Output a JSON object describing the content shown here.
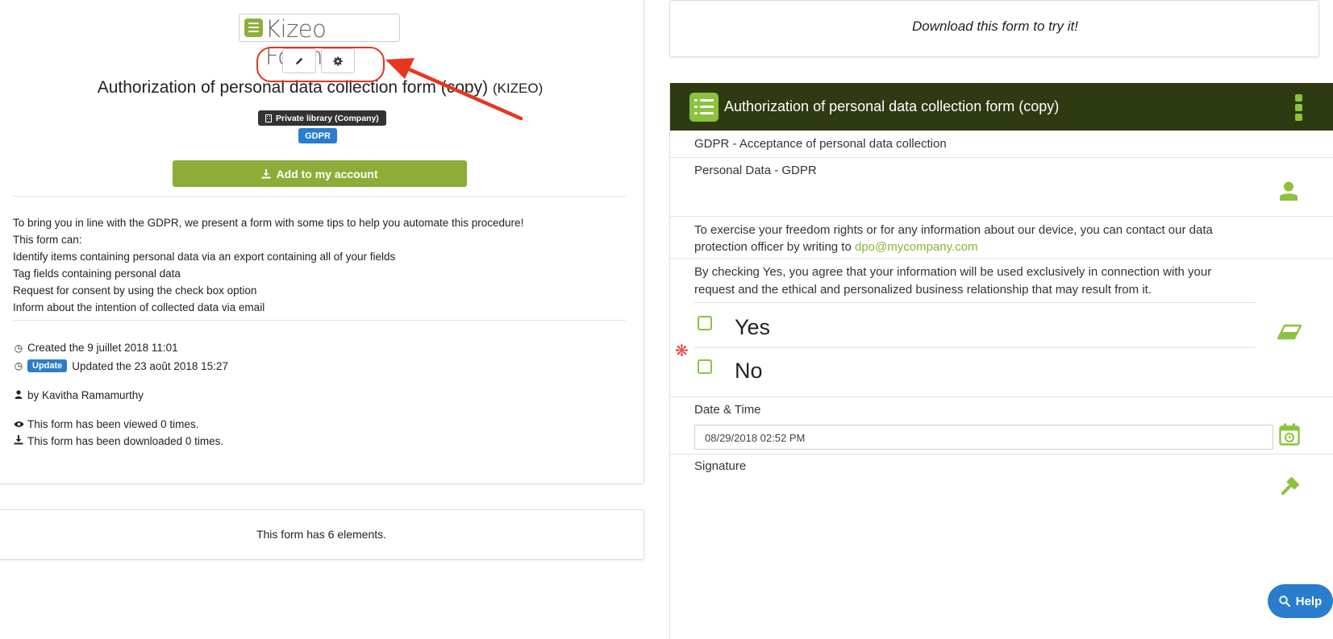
{
  "logo": {
    "text": "Kizeo Forms"
  },
  "toolbar": {
    "edit_icon": "pencil-icon",
    "settings_icon": "gear-icon"
  },
  "form": {
    "title": "Authorization of personal data collection form (copy)",
    "owner_suffix": "(KIZEO)",
    "library_badge": "Private library (Company)",
    "tag_badge": "GDPR",
    "add_button": "Add to my account"
  },
  "description": {
    "lines": [
      "To bring you in line with the GDPR, we present a form with some tips to help you automate this procedure!",
      "This form can:",
      "Identify items containing personal data via an export containing all of your fields",
      "Tag fields containing personal data",
      "Request for consent by using the check box option",
      "Inform about the intention of collected data via email"
    ]
  },
  "meta": {
    "created": "Created the 9 juillet 2018 11:01",
    "update_badge": "Update",
    "updated": "Updated the 23 août 2018 15:27",
    "author": "by Kavitha Ramamurthy",
    "views": "This form has been viewed 0 times.",
    "downloads": "This form has been downloaded 0 times."
  },
  "elements_count": "This form has 6 elements.",
  "download_prompt": "Download this form to try it!",
  "preview": {
    "title": "Authorization of personal data collection form (copy)",
    "section_label": "GDPR - Acceptance of personal data collection",
    "personal_data_label": "Personal Data - GDPR",
    "info_text": "To exercise your freedom rights or for any information about our device, you can contact our data protection officer by writing to",
    "email": "dpo@mycompany.com",
    "consent_text": "By checking Yes, you agree that your information will be used exclusively in connection with your request and the ethical and personalized business relationship that may result from it.",
    "choices": [
      "Yes",
      "No"
    ],
    "required_mark": "❋",
    "date_label": "Date & Time",
    "date_value": "08/29/2018 02:52 PM",
    "signature_label": "Signature"
  },
  "help": {
    "label": "Help"
  },
  "colors": {
    "accent_green": "#8cae38",
    "header_dark": "#2e3a12",
    "badge_blue": "#2a7dcc",
    "annotation_red": "#e8361e"
  }
}
